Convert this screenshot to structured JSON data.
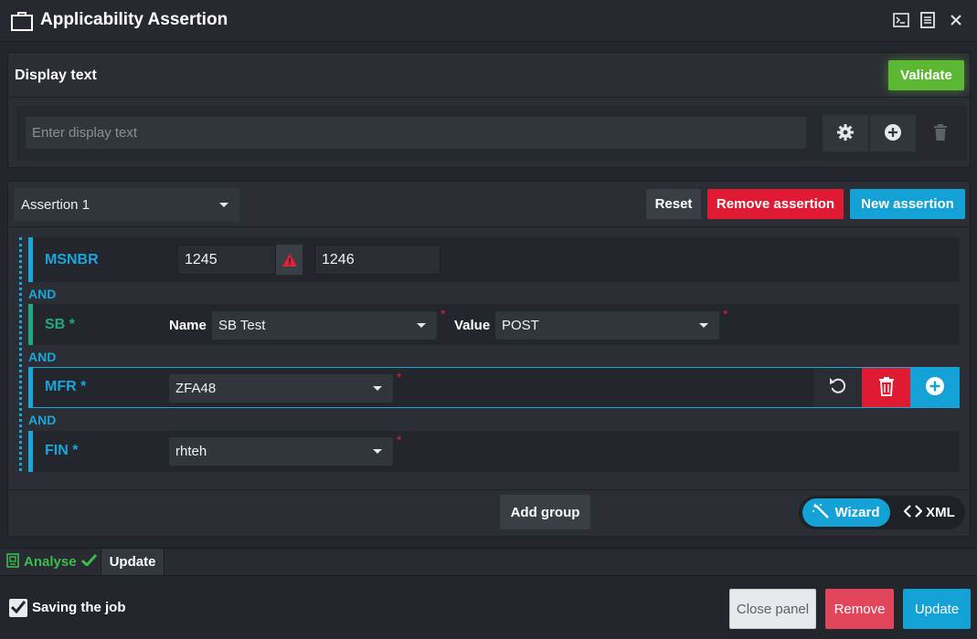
{
  "window": {
    "title": "Applicability Assertion",
    "icons": [
      "briefcase-icon",
      "terminal-icon",
      "document-icon",
      "close-icon"
    ]
  },
  "display": {
    "label": "Display text",
    "validate_label": "Validate",
    "input_placeholder": "Enter display text",
    "input_value": "",
    "icons": [
      "gear-icon",
      "plus-circle-icon",
      "trash-icon"
    ]
  },
  "assertion": {
    "selected": "Assertion 1",
    "reset_label": "Reset",
    "remove_label": "Remove assertion",
    "new_label": "New assertion",
    "rows": {
      "msnbr": {
        "label": "MSNBR",
        "from": "1245",
        "to": "1246",
        "bar_color": "#1aa6db"
      },
      "sb": {
        "label": "SB *",
        "name_label": "Name",
        "name_value": "SB Test",
        "value_label": "Value",
        "value_value": "POST",
        "bar_color": "#1faa83"
      },
      "mfr": {
        "label": "MFR *",
        "value": "ZFA48",
        "bar_color": "#1aa6db"
      },
      "fin": {
        "label": "FIN *",
        "value": "rhteh",
        "bar_color": "#1aa6db"
      }
    },
    "and_label": "AND",
    "required_mark": "*",
    "add_group_label": "Add group",
    "mode": {
      "wizard_label": "Wizard",
      "xml_label": "XML",
      "active": "Wizard"
    }
  },
  "tabs": {
    "analyse_label": "Analyse",
    "update_label": "Update"
  },
  "footer": {
    "saving_label": "Saving the job",
    "saving_checked": true,
    "close_label": "Close panel",
    "remove_label": "Remove",
    "update_label": "Update"
  },
  "colors": {
    "accent_blue": "#14a2d6",
    "danger_red": "#e11a33",
    "validate_green": "#5cb832",
    "analyse_green": "#3dbb4b"
  }
}
